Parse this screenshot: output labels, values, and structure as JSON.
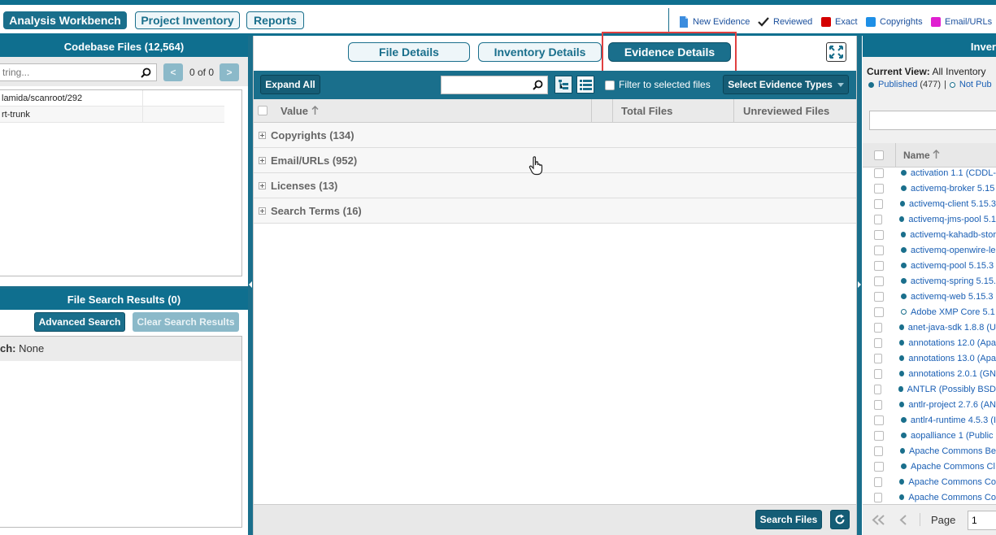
{
  "top_nav": {
    "tabs": [
      {
        "label": "Analysis Workbench",
        "active": true
      },
      {
        "label": "Project Inventory",
        "active": false
      },
      {
        "label": "Reports",
        "active": false
      }
    ],
    "legend": [
      {
        "label": "New Evidence",
        "icon": "document-icon",
        "color": "#3c8dde"
      },
      {
        "label": "Reviewed",
        "icon": "checkmark-icon",
        "color": "#222222"
      },
      {
        "label": "Exact",
        "icon": "square-icon",
        "color": "#d40000"
      },
      {
        "label": "Copyrights",
        "icon": "square-icon",
        "color": "#1e8fe6"
      },
      {
        "label": "Email/URLs",
        "icon": "square-icon",
        "color": "#e020d0"
      }
    ]
  },
  "codebase_files": {
    "title": "Codebase Files (12,564)",
    "filter_placeholder": "tring...",
    "page_counter": "0 of 0",
    "prev_label": "<",
    "next_label": ">",
    "tree": [
      {
        "label": "lamida/scanroot/292"
      },
      {
        "label": "rt-trunk"
      }
    ]
  },
  "file_search": {
    "title": "File Search Results (0)",
    "advanced_label": "Advanced Search",
    "clear_label": "Clear Search Results",
    "search_label": "ch:",
    "search_value": "None"
  },
  "center": {
    "tabs": [
      {
        "label": "File Details",
        "active": false
      },
      {
        "label": "Inventory Details",
        "active": false
      },
      {
        "label": "Evidence Details",
        "active": true
      }
    ],
    "toolbar": {
      "expand_all": "Expand All",
      "search_placeholder": "",
      "filter_label": "Filter to selected files",
      "select_types": "Select Evidence Types"
    },
    "columns": [
      "Value",
      "Total Files",
      "Unreviewed Files"
    ],
    "groups": [
      {
        "label": "Copyrights (134)"
      },
      {
        "label": "Email/URLs (952)"
      },
      {
        "label": "Licenses (13)"
      },
      {
        "label": "Search Terms (16)"
      }
    ],
    "search_files_label": "Search Files"
  },
  "inventory": {
    "title": "Inver",
    "current_view_label": "Current View:",
    "current_view_value": "All Inventory",
    "published_label": "Published",
    "published_count": "(477)",
    "not_published_label": "Not Pub",
    "column_name": "Name",
    "items": [
      {
        "label": "activation 1.1 (CDDL-",
        "published": true
      },
      {
        "label": "activemq-broker 5.15",
        "published": true
      },
      {
        "label": "activemq-client 5.15.3",
        "published": true
      },
      {
        "label": "activemq-jms-pool 5.1",
        "published": true
      },
      {
        "label": "activemq-kahadb-stor",
        "published": true
      },
      {
        "label": "activemq-openwire-le",
        "published": true
      },
      {
        "label": "activemq-pool 5.15.3",
        "published": true
      },
      {
        "label": "activemq-spring 5.15.",
        "published": true
      },
      {
        "label": "activemq-web 5.15.3",
        "published": true
      },
      {
        "label": "Adobe XMP Core 5.1",
        "published": false
      },
      {
        "label": "anet-java-sdk 1.8.8 (U",
        "published": true
      },
      {
        "label": "annotations 12.0 (Apa",
        "published": true
      },
      {
        "label": "annotations 13.0 (Apa",
        "published": true
      },
      {
        "label": "annotations 2.0.1 (GN",
        "published": true
      },
      {
        "label": "ANTLR (Possibly BSD",
        "published": true
      },
      {
        "label": "antlr-project 2.7.6 (AN",
        "published": true
      },
      {
        "label": "antlr4-runtime 4.5.3 (I",
        "published": true
      },
      {
        "label": "aopalliance 1 (Public",
        "published": true
      },
      {
        "label": "Apache Commons Be",
        "published": true
      },
      {
        "label": "Apache Commons Cl",
        "published": true
      },
      {
        "label": "Apache Commons Co",
        "published": true
      },
      {
        "label": "Apache Commons Co",
        "published": true
      }
    ],
    "page_label": "Page",
    "page_value": "1"
  }
}
